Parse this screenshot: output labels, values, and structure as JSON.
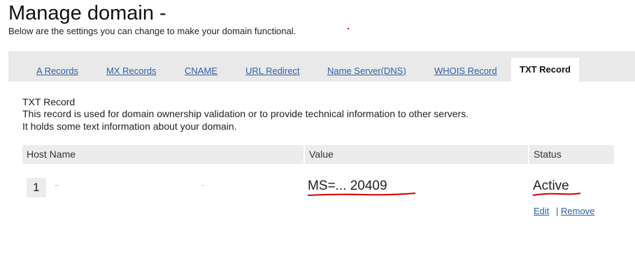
{
  "header": {
    "title": "Manage domain -",
    "subtitle": "Below are the settings you can change to make your domain functional."
  },
  "tabs": [
    {
      "label": "A Records",
      "active": false
    },
    {
      "label": "MX Records",
      "active": false
    },
    {
      "label": "CNAME",
      "active": false
    },
    {
      "label": "URL Redirect",
      "active": false
    },
    {
      "label": "Name Server(DNS)",
      "active": false
    },
    {
      "label": "WHOIS Record",
      "active": false
    },
    {
      "label": "TXT Record",
      "active": true
    }
  ],
  "section": {
    "title": "TXT Record",
    "description_lines": [
      "This record is used for domain ownership validation or to provide technical information to other servers.",
      "It holds some text information about your domain."
    ]
  },
  "table": {
    "headers": [
      "Host Name",
      "Value",
      "Status"
    ],
    "rows": [
      {
        "index": "1",
        "host_name": "",
        "value": "MS=... 20409",
        "status": "Active",
        "actions": {
          "edit": "Edit",
          "separator": "|",
          "remove": "Remove"
        }
      }
    ]
  },
  "colors": {
    "link": "#2f5fa3",
    "tabbar_bg": "#e9e9e9",
    "header_bg": "#ececec",
    "annotation": "#d00000"
  }
}
